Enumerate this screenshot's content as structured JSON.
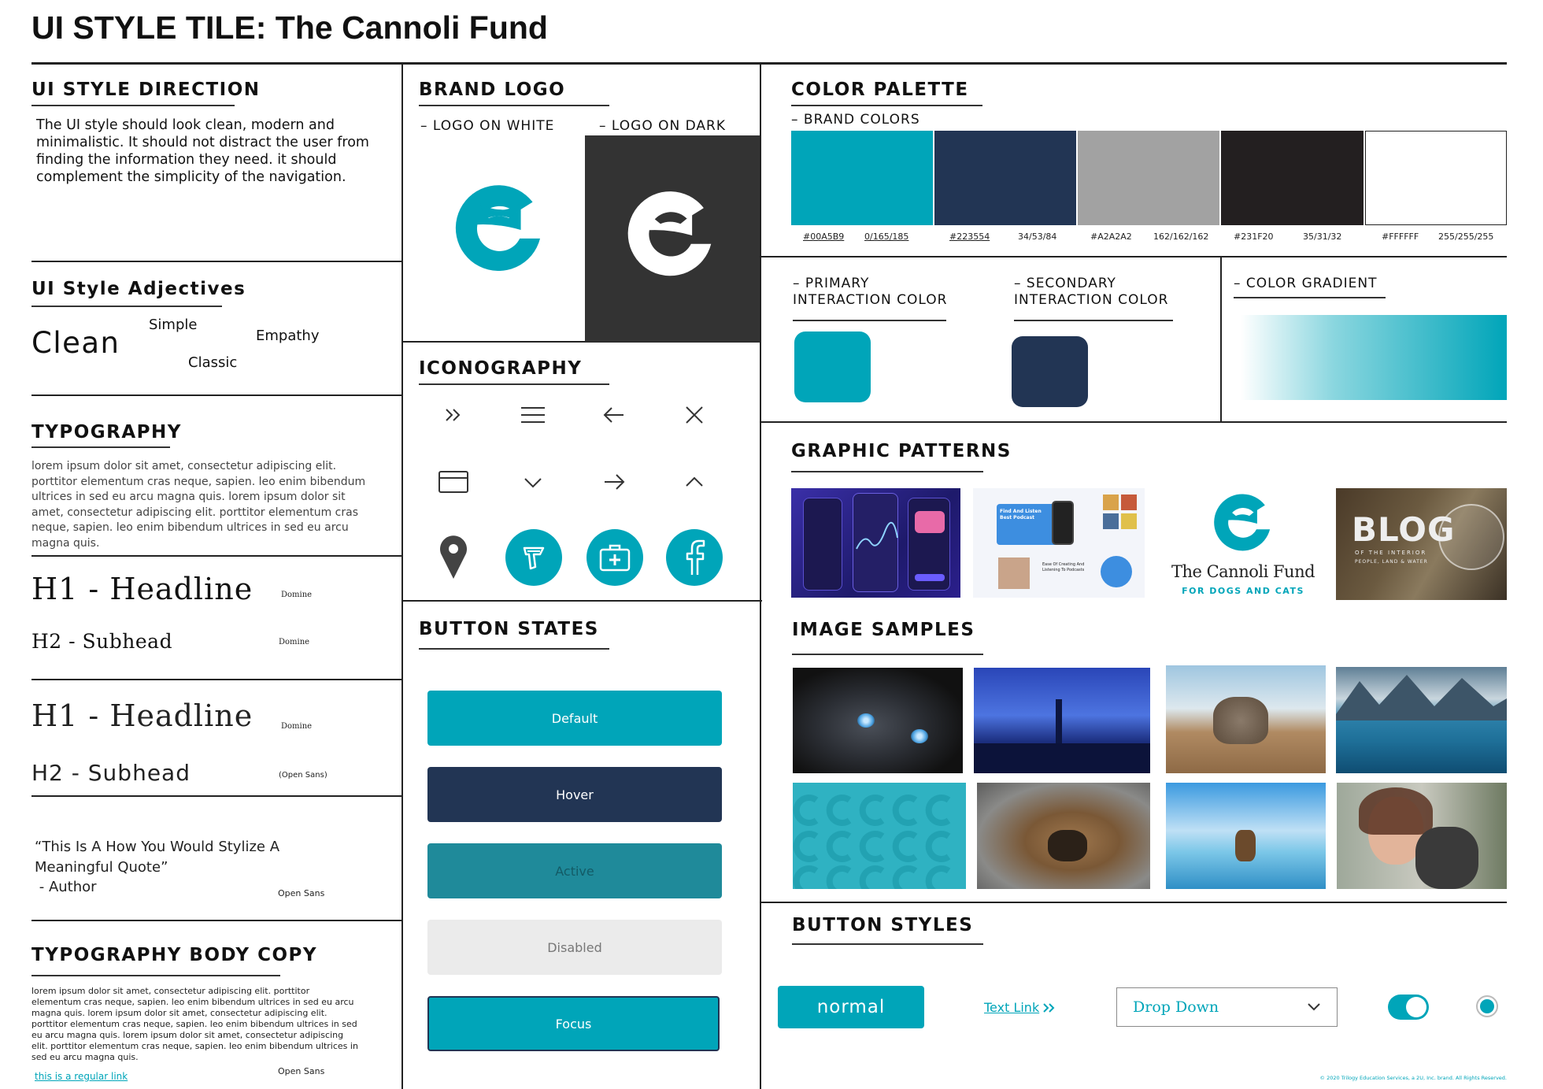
{
  "page_title": "UI STYLE TILE: The Cannoli Fund",
  "colors": {
    "teal": "#00A5B9",
    "navy": "#223554",
    "gray": "#A2A2A2",
    "black": "#231F20",
    "white": "#FFFFFF",
    "dark_panel": "#333333",
    "active": "#1F8A9A",
    "disabled": "#EBEBEB"
  },
  "style_direction": {
    "title": "UI STYLE DIRECTION",
    "body": "The UI style should look clean, modern and minimalistic. It should not distract the user from finding the information they need. it should complement the simplicity of the navigation."
  },
  "adjectives": {
    "title": "UI Style Adjectives",
    "words": [
      "Clean",
      "Simple",
      "Empathy",
      "Classic"
    ]
  },
  "typography": {
    "title": "TYPOGRAPHY",
    "lorem": "lorem ipsum dolor sit amet, consectetur adipiscing elit. porttitor elementum cras neque, sapien. leo enim bibendum ultrices in sed eu arcu magna quis. lorem ipsum dolor sit amet, consectetur adipiscing elit. porttitor elementum cras neque, sapien. leo enim bibendum ultrices in sed eu arcu magna quis.",
    "h1_a": "H1 - Headline",
    "h1_a_font": "Domine",
    "h2_a": "H2 - Subhead",
    "h2_a_font": "Domine",
    "h1_b": "H1 - Headline",
    "h1_b_font": "Domine",
    "h2_b": "H2 - Subhead",
    "h2_b_font": "(Open Sans)",
    "quote": "“This Is A How You Would Stylize A Meaningful Quote”",
    "author": " - Author",
    "quote_font": "Open Sans"
  },
  "body_copy": {
    "title": "TYPOGRAPHY BODY COPY",
    "text": "lorem ipsum dolor sit amet, consectetur adipiscing elit. porttitor elementum cras neque, sapien. leo enim bibendum ultrices in sed eu arcu magna quis. lorem ipsum dolor sit amet, consectetur adipiscing elit. porttitor elementum cras neque, sapien. leo enim bibendum ultrices in sed eu arcu magna quis. lorem ipsum dolor sit amet, consectetur adipiscing elit. porttitor elementum cras neque, sapien. leo enim bibendum ultrices in sed eu arcu magna quis.",
    "link": "this is a regular link",
    "font": "Open Sans"
  },
  "brand_logo": {
    "title": "BRAND LOGO",
    "on_white": "– LOGO ON WHITE",
    "on_dark": "– LOGO ON DARK"
  },
  "iconography": {
    "title": "ICONOGRAPHY",
    "icons": [
      "double-chevron-right-icon",
      "hamburger-menu-icon",
      "arrow-left-icon",
      "close-icon",
      "card-icon",
      "chevron-down-icon",
      "arrow-right-icon",
      "chevron-up-icon",
      "map-pin-icon",
      "grooming-icon",
      "first-aid-kit-icon",
      "facebook-icon"
    ]
  },
  "button_states": {
    "title": "BUTTON STATES",
    "default": "Default",
    "hover": "Hover",
    "active": "Active",
    "disabled": "Disabled",
    "focus": "Focus"
  },
  "palette": {
    "title": "COLOR PALETTE",
    "brand_label": "– BRAND COLORS",
    "swatches": [
      {
        "hex": "#00A5B9",
        "rgb": "0/165/185"
      },
      {
        "hex": "#223554",
        "rgb": "34/53/84"
      },
      {
        "hex": "#A2A2A2",
        "rgb": "162/162/162"
      },
      {
        "hex": "#231F20",
        "rgb": "35/31/32"
      },
      {
        "hex": "#FFFFFF",
        "rgb": "255/255/255"
      }
    ]
  },
  "interaction": {
    "primary_line1": "– PRIMARY",
    "primary_line2": "INTERACTION COLOR",
    "secondary_line1": "– SECONDARY",
    "secondary_line2": "INTERACTION COLOR",
    "gradient": "– COLOR GRADIENT"
  },
  "patterns": {
    "title": "GRAPHIC PATTERNS",
    "logo_name": "The Cannoli Fund",
    "logo_tag": "FOR DOGS AND CATS",
    "blog_word": "BLOG",
    "blog_sub": "OF THE INTERIOR",
    "blog_sub2": "PEOPLE, LAND & WATER",
    "app_text1": "Find And Listen Best Podcast",
    "app_text2": "Ease Of Creating And Listening To Podcasts"
  },
  "image_samples": {
    "title": "IMAGE SAMPLES"
  },
  "button_styles": {
    "title": "BUTTON STYLES",
    "normal": "normal",
    "text_link": "Text Link",
    "dropdown": "Drop Down"
  },
  "footer": "© 2020 Trilogy Education Services, a 2U, Inc. brand. All Rights Reserved."
}
